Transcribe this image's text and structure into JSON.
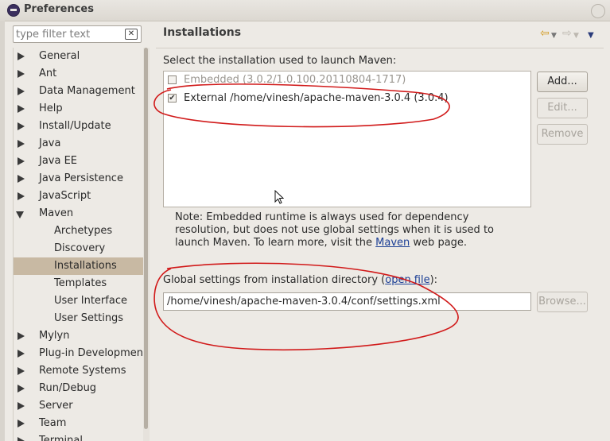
{
  "window": {
    "title": "Preferences"
  },
  "filter": {
    "placeholder": "type filter text"
  },
  "tree": {
    "items": [
      {
        "label": "General",
        "level": 0,
        "expanded": false
      },
      {
        "label": "Ant",
        "level": 0,
        "expanded": false
      },
      {
        "label": "Data Management",
        "level": 0,
        "expanded": false
      },
      {
        "label": "Help",
        "level": 0,
        "expanded": false
      },
      {
        "label": "Install/Update",
        "level": 0,
        "expanded": false
      },
      {
        "label": "Java",
        "level": 0,
        "expanded": false
      },
      {
        "label": "Java EE",
        "level": 0,
        "expanded": false
      },
      {
        "label": "Java Persistence",
        "level": 0,
        "expanded": false
      },
      {
        "label": "JavaScript",
        "level": 0,
        "expanded": false
      },
      {
        "label": "Maven",
        "level": 0,
        "expanded": true
      },
      {
        "label": "Archetypes",
        "level": 1
      },
      {
        "label": "Discovery",
        "level": 1
      },
      {
        "label": "Installations",
        "level": 1,
        "selected": true
      },
      {
        "label": "Templates",
        "level": 1
      },
      {
        "label": "User Interface",
        "level": 1
      },
      {
        "label": "User Settings",
        "level": 1
      },
      {
        "label": "Mylyn",
        "level": 0,
        "expanded": false
      },
      {
        "label": "Plug-in Development",
        "level": 0,
        "expanded": false
      },
      {
        "label": "Remote Systems",
        "level": 0,
        "expanded": false
      },
      {
        "label": "Run/Debug",
        "level": 0,
        "expanded": false
      },
      {
        "label": "Server",
        "level": 0,
        "expanded": false
      },
      {
        "label": "Team",
        "level": 0,
        "expanded": false
      },
      {
        "label": "Terminal",
        "level": 0,
        "expanded": false
      }
    ]
  },
  "page": {
    "title": "Installations",
    "select_label": "Select the installation used to launch Maven:",
    "installations": [
      {
        "label": "Embedded (3.0.2/1.0.100.20110804-1717)",
        "checked": false,
        "enabled": false
      },
      {
        "label": "External /home/vinesh/apache-maven-3.0.4 (3.0.4)",
        "checked": true,
        "enabled": true
      }
    ],
    "buttons": {
      "add": "Add...",
      "edit": "Edit...",
      "remove": "Remove"
    },
    "note": {
      "text": "Note: Embedded runtime is always used for dependency resolution, but does not use global settings when it is used to launch Maven. To learn more, visit the ",
      "link": "Maven",
      "suffix": " web page."
    },
    "global": {
      "prefix": "Global settings from installation directory (",
      "link": "open file",
      "suffix": "):",
      "value": "/home/vinesh/apache-maven-3.0.4/conf/settings.xml",
      "browse": "Browse..."
    }
  },
  "icons": {
    "back": "back-arrow-icon",
    "forward": "forward-arrow-icon",
    "menu": "view-menu-icon",
    "clear": "clear-filter-icon"
  },
  "colors": {
    "selection": "#c8b9a3",
    "link": "#1c3f95",
    "annotation": "#d11a1a"
  }
}
